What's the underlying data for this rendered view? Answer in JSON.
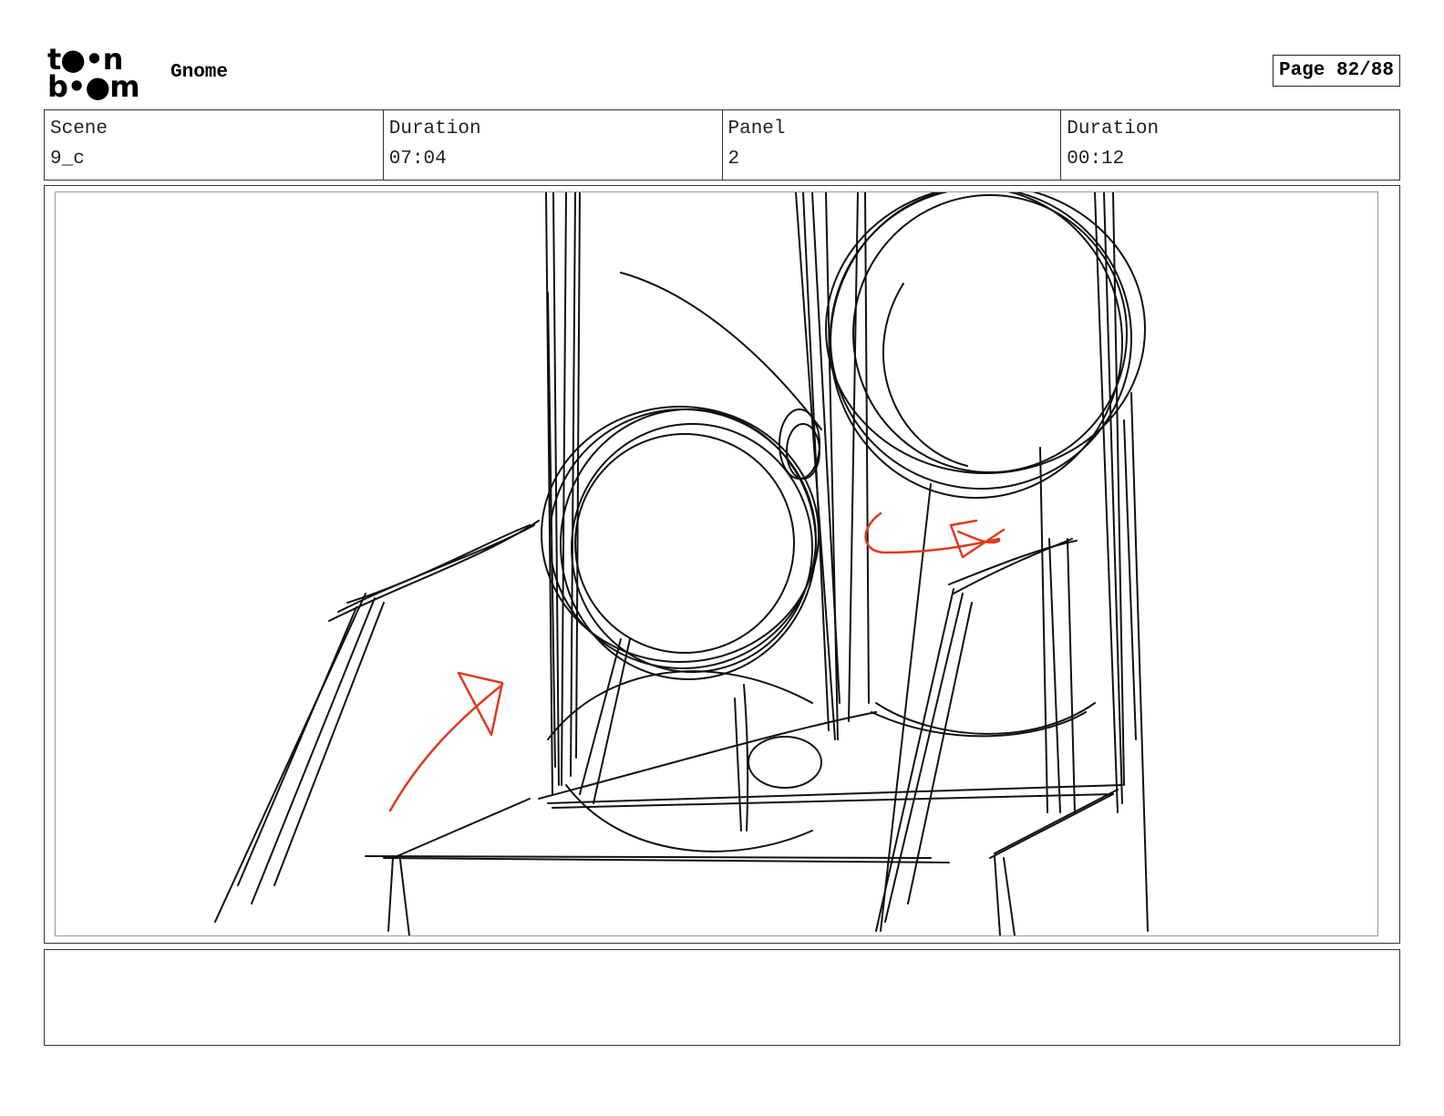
{
  "header": {
    "logo_line1": "t●•n",
    "logo_line2": "b•●m",
    "project_title": "Gnome",
    "page_label": "Page 82/88"
  },
  "info": [
    {
      "label": "Scene",
      "value": "9_c"
    },
    {
      "label": "Duration",
      "value": "07:04"
    },
    {
      "label": "Panel",
      "value": "2"
    },
    {
      "label": "Duration",
      "value": "00:12"
    }
  ],
  "notes": {
    "text": ""
  },
  "colors": {
    "sketch": "#111111",
    "annotation": "#e03a1e",
    "border": "#333333"
  }
}
